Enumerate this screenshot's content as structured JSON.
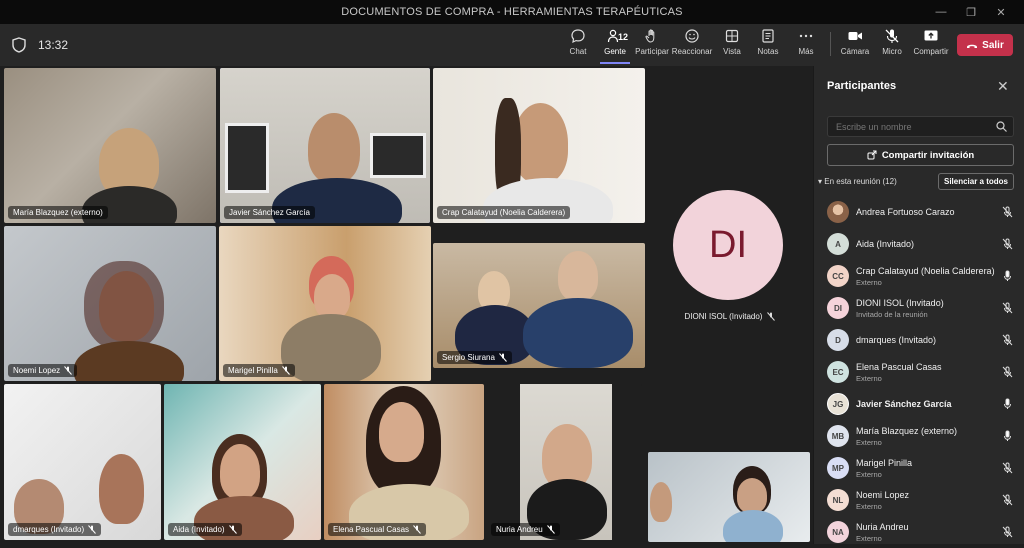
{
  "window": {
    "title": "DOCUMENTOS DE COMPRA - HERRAMIENTAS TERAPÉUTICAS",
    "minimize": "—",
    "maximize": "❐",
    "close": "✕"
  },
  "toolbar": {
    "time": "13:32",
    "people_count": "12",
    "buttons": {
      "chat": "Chat",
      "people": "Gente",
      "raise": "Participar",
      "react": "Reaccionar",
      "view": "Vista",
      "notes": "Notas",
      "more": "Más",
      "camera": "Cámara",
      "mic": "Micro",
      "share": "Compartir",
      "leave": "Salir"
    },
    "accent_color": "#7f85f5",
    "leave_color": "#c4314b"
  },
  "tiles": [
    {
      "name": "María Blazquez (externo)",
      "muted": false
    },
    {
      "name": "Javier Sánchez García",
      "muted": false,
      "speaking": true
    },
    {
      "name": "Crap Calatayud (Noelia Calderera)",
      "muted": false
    },
    {
      "name": "Noemi Lopez",
      "muted": true
    },
    {
      "name": "Marigel Pinilla",
      "muted": true
    },
    {
      "name": "Sergio Siurana",
      "muted": true
    },
    {
      "name": "dmarques (Invitado)",
      "muted": true
    },
    {
      "name": "Aida (Invitado)",
      "muted": true
    },
    {
      "name": "Elena Pascual Casas",
      "muted": true
    },
    {
      "name": "Nuria Andreu",
      "muted": true
    }
  ],
  "avatar_tile": {
    "initials": "DI",
    "name": "DIONI ISOL (Invitado)",
    "muted": true
  },
  "panel": {
    "title": "Participantes",
    "close": "✕",
    "search_placeholder": "Escribe un nombre",
    "share_invite": "Compartir invitación",
    "in_meeting": "En esta reunión (12)",
    "mute_all": "Silenciar a todos",
    "participants": [
      {
        "initials": "",
        "name": "Andrea Fortuoso Carazo",
        "sub": "",
        "mic": "off",
        "color": "#c9a88f"
      },
      {
        "initials": "A",
        "name": "Aida (Invitado)",
        "sub": "",
        "mic": "off",
        "color": "#d4ded8"
      },
      {
        "initials": "CC",
        "name": "Crap Calatayud (Noelia Calderera)",
        "sub": "Externo",
        "mic": "on",
        "color": "#f2d4c8"
      },
      {
        "initials": "DI",
        "name": "DIONI ISOL (Invitado)",
        "sub": "Invitado de la reunión",
        "mic": "off",
        "color": "#f5d3da"
      },
      {
        "initials": "D",
        "name": "dmarques (Invitado)",
        "sub": "",
        "mic": "off",
        "color": "#d7dde8"
      },
      {
        "initials": "EC",
        "name": "Elena Pascual Casas",
        "sub": "Externo",
        "mic": "off",
        "color": "#cfe3e0"
      },
      {
        "initials": "JG",
        "name": "Javier Sánchez García",
        "sub": "",
        "mic": "on",
        "color": "#e8e2d6",
        "bold": true
      },
      {
        "initials": "MB",
        "name": "María Blazquez (externo)",
        "sub": "Externo",
        "mic": "on",
        "color": "#dfe4ee"
      },
      {
        "initials": "MP",
        "name": "Marigel Pinilla",
        "sub": "Externo",
        "mic": "off",
        "color": "#d9def5"
      },
      {
        "initials": "NL",
        "name": "Noemi Lopez",
        "sub": "Externo",
        "mic": "off",
        "color": "#f3ddd3"
      },
      {
        "initials": "NA",
        "name": "Nuria Andreu",
        "sub": "Externo",
        "mic": "off",
        "color": "#f3d4dc"
      }
    ]
  }
}
